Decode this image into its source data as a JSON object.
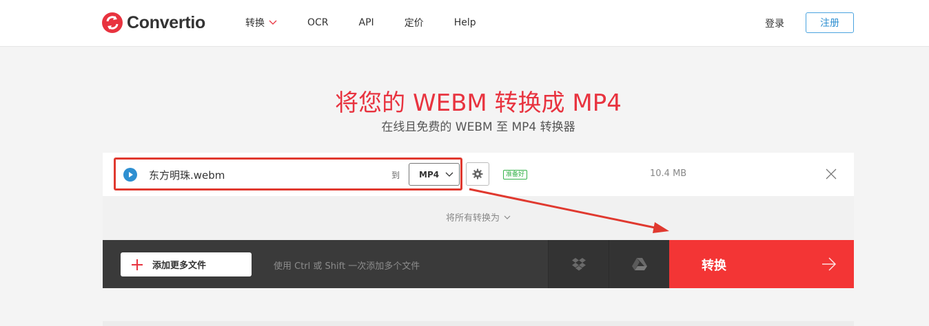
{
  "header": {
    "logo_text": "Convertio",
    "nav": [
      {
        "label": "转换",
        "has_dropdown": true
      },
      {
        "label": "OCR"
      },
      {
        "label": "API"
      },
      {
        "label": "定价"
      },
      {
        "label": "Help"
      }
    ],
    "login_label": "登录",
    "signup_label": "注册"
  },
  "hero": {
    "title": "将您的 WEBM 转换成 MP4",
    "subtitle": "在线且免费的 WEBM 至 MP4 转换器"
  },
  "file": {
    "icon": "play-icon",
    "name": "东方明珠.webm",
    "to_label": "到",
    "format": "MP4",
    "status": "准备好",
    "size": "10.4 MB"
  },
  "convert_all_label": "将所有转换为",
  "bottom": {
    "add_label": "添加更多文件",
    "hint": "使用 Ctrl 或 Shift 一次添加多个文件",
    "convert_label": "转换"
  },
  "colors": {
    "brand_red": "#e8333f",
    "convert_red": "#f33535",
    "ready_green": "#35b24a",
    "signup_blue": "#2e8fd1"
  }
}
